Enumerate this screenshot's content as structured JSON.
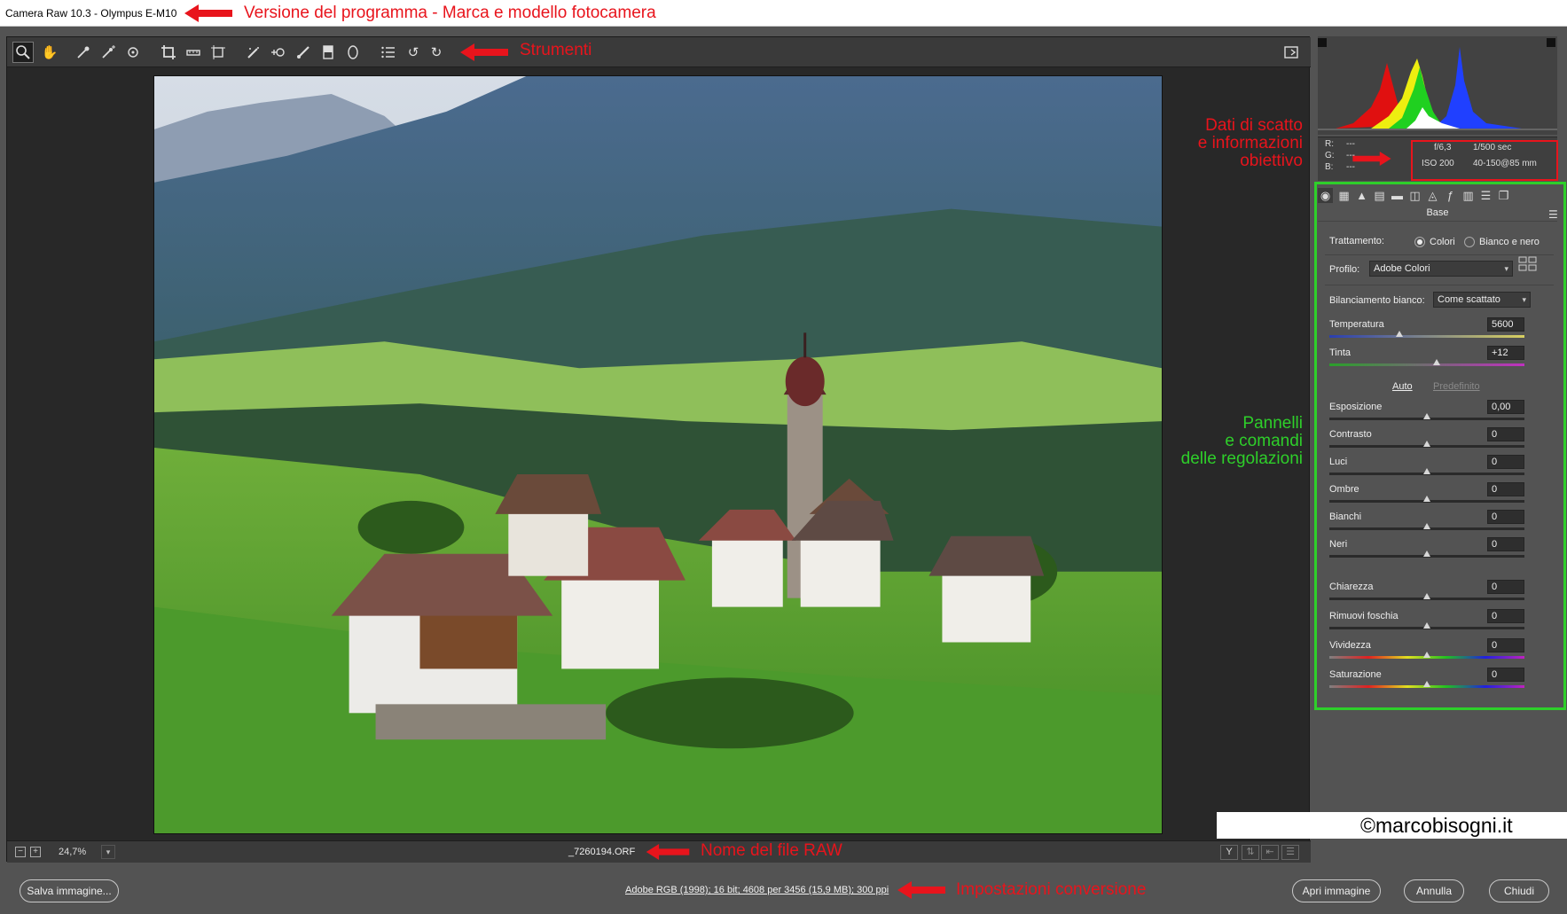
{
  "window": {
    "title": "Camera Raw 10.3  -  Olympus E-M10"
  },
  "annotations": {
    "version_label": "Versione del programma - Marca e modello fotocamera",
    "tools_label": "Strumenti",
    "shot_data_line1": "Dati di scatto",
    "shot_data_line2": "e informazioni",
    "shot_data_line3": "obiettivo",
    "panels_line1": "Pannelli",
    "panels_line2": "e comandi",
    "panels_line3": "delle regolazioni",
    "filename_label": "Nome del file RAW",
    "conversion_label": "Impostazioni conversione"
  },
  "colors": {
    "annotation_red": "#e8141c",
    "annotation_green": "#2ecf2a",
    "app_bg": "#535353"
  },
  "toolbar": {
    "tools": [
      "zoom-icon",
      "hand-icon",
      "eyedropper-icon",
      "color-sampler-icon",
      "targeted-adjust-icon",
      "crop-icon",
      "straighten-icon",
      "transform-icon",
      "spot-removal-icon",
      "red-eye-icon",
      "brush-icon",
      "graduated-filter-icon",
      "radial-filter-icon",
      "preferences-icon",
      "rotate-left-icon",
      "rotate-right-icon"
    ],
    "fullscreen_icon": "fullscreen-icon"
  },
  "status": {
    "zoom_out": "−",
    "zoom_in": "+",
    "zoom": "24,7%",
    "zoom_dropdown": "▾",
    "filename": "_7260194.ORF",
    "view_before_after": "Y"
  },
  "info": {
    "r_label": "R:",
    "g_label": "G:",
    "b_label": "B:",
    "r": "---",
    "g": "---",
    "b": "---",
    "aperture": "f/6,3",
    "shutter": "1/500 sec",
    "iso": "ISO 200",
    "lens": "40-150@85 mm"
  },
  "panel": {
    "title": "Base",
    "treatment_label": "Trattamento:",
    "treatment_color": "Colori",
    "treatment_bw": "Bianco e nero",
    "profile_label": "Profilo:",
    "profile_value": "Adobe Colori",
    "wb_label": "Bilanciamento bianco:",
    "wb_value": "Come scattato",
    "auto": "Auto",
    "default": "Predefinito",
    "sliders": [
      {
        "label": "Temperatura",
        "value": "5600",
        "level": 0.36
      },
      {
        "label": "Tinta",
        "value": "+12",
        "level": 0.55
      },
      {
        "label": "Esposizione",
        "value": "0,00",
        "level": 0.5
      },
      {
        "label": "Contrasto",
        "value": "0",
        "level": 0.5
      },
      {
        "label": "Luci",
        "value": "0",
        "level": 0.5
      },
      {
        "label": "Ombre",
        "value": "0",
        "level": 0.5
      },
      {
        "label": "Bianchi",
        "value": "0",
        "level": 0.5
      },
      {
        "label": "Neri",
        "value": "0",
        "level": 0.5
      },
      {
        "label": "Chiarezza",
        "value": "0",
        "level": 0.5
      },
      {
        "label": "Rimuovi foschia",
        "value": "0",
        "level": 0.5
      },
      {
        "label": "Vividezza",
        "value": "0",
        "level": 0.5
      },
      {
        "label": "Saturazione",
        "value": "0",
        "level": 0.5
      }
    ]
  },
  "footer": {
    "save": "Salva immagine...",
    "conversion": "Adobe RGB (1998); 16 bit; 4608 per 3456 (15,9 MB); 300 ppi",
    "open": "Apri immagine",
    "cancel": "Annulla",
    "done": "Chiudi"
  },
  "watermark": "©marcobisogni.it"
}
